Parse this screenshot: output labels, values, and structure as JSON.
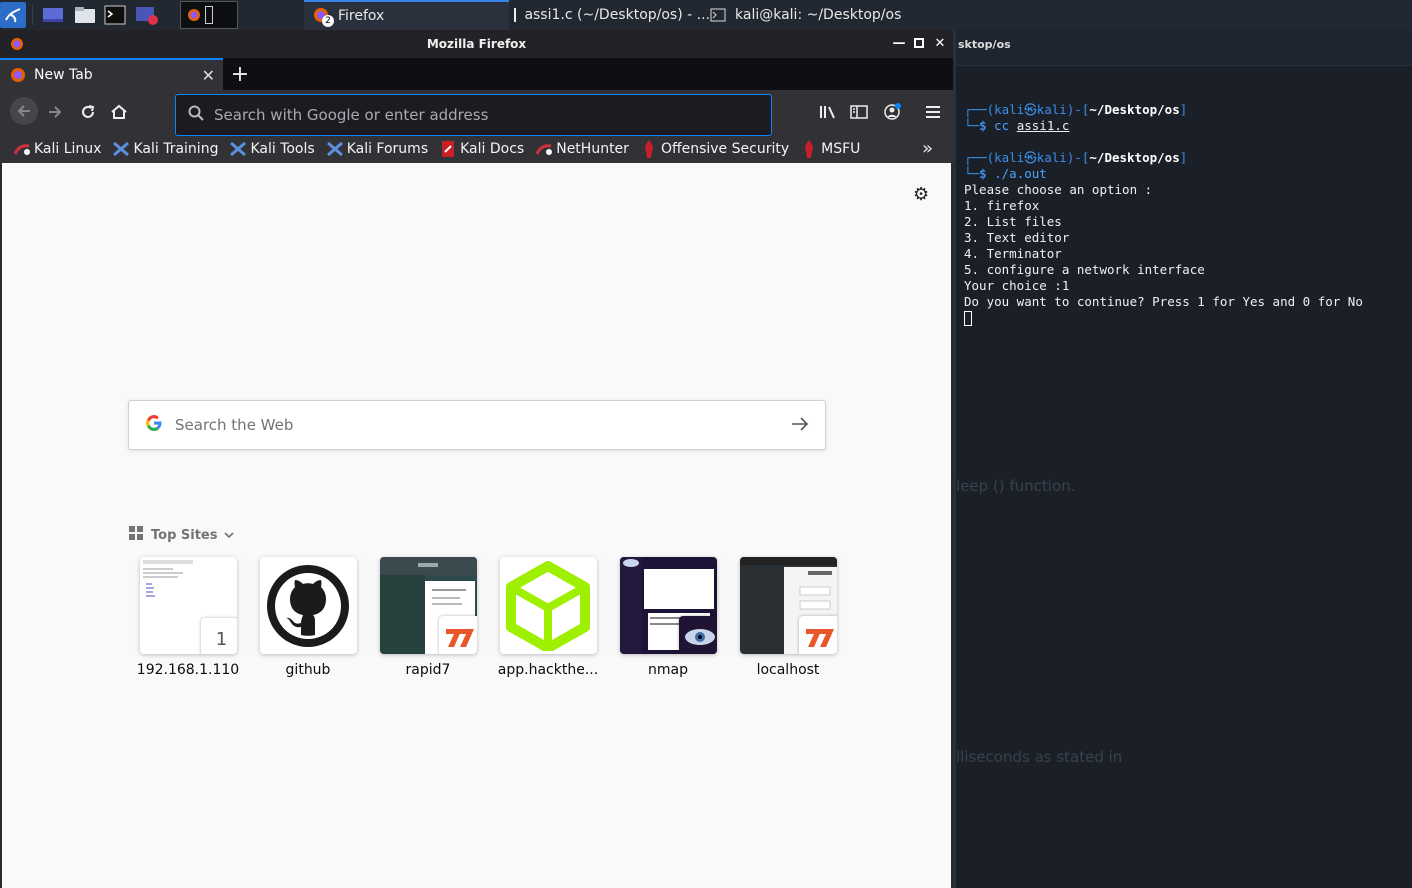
{
  "taskbar": {
    "tasks": [
      {
        "label": "Firefox",
        "badge": "2"
      },
      {
        "label": "assi1.c (~/Desktop/os) - ..."
      },
      {
        "label": "kali@kali: ~/Desktop/os"
      }
    ]
  },
  "firefox": {
    "window_title": "Mozilla Firefox",
    "tab_label": "New Tab",
    "url_placeholder": "Search with Google or enter address",
    "bookmarks": [
      "Kali Linux",
      "Kali Training",
      "Kali Tools",
      "Kali Forums",
      "Kali Docs",
      "NetHunter",
      "Offensive Security",
      "MSFU"
    ],
    "web_search_placeholder": "Search the Web",
    "top_sites_label": "Top Sites",
    "top_sites": [
      {
        "label": "192.168.1.110",
        "badge": "1"
      },
      {
        "label": "github"
      },
      {
        "label": "rapid7"
      },
      {
        "label": "app.hackthe..."
      },
      {
        "label": "nmap"
      },
      {
        "label": "localhost"
      }
    ]
  },
  "terminal": {
    "header_path": "sktop/os",
    "prompt_user": "kali㉿kali",
    "prompt_dir": "~/Desktop/os",
    "cmd1": "cc",
    "cmd1_arg": "assi1.c",
    "cmd2": "./a.out",
    "output": [
      "Please choose an option :",
      "1. firefox",
      "2. List files",
      "3. Text editor",
      "4. Terminator",
      "5. configure a network interface",
      "Your choice :1",
      "Do you want to continue? Press 1 for Yes and 0 for No"
    ],
    "ghost_texts": [
      "leep () function.",
      "lliseconds as stated in"
    ]
  }
}
